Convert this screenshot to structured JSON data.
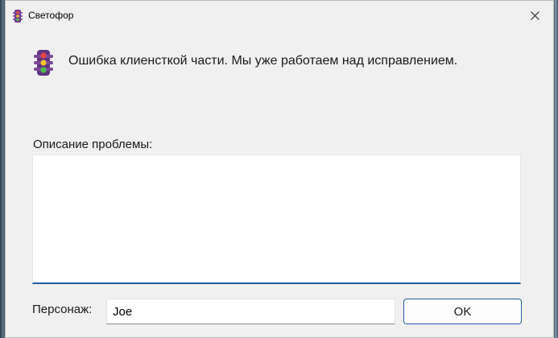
{
  "window": {
    "title": "Светофор",
    "close_icon": "close-icon",
    "app_icon": "traffic-light-icon"
  },
  "message": {
    "icon": "traffic-light-icon",
    "text": "Ошибка клиенсткой части. Мы уже работаем над исправлением."
  },
  "description": {
    "label": "Описание проблемы:",
    "value": "",
    "placeholder": ""
  },
  "character": {
    "label": "Персонаж:",
    "value": "Joe"
  },
  "buttons": {
    "ok_label": "OK"
  },
  "colors": {
    "accent": "#1f5f9e",
    "window_bg": "#f0f0f0",
    "traffic_light_body": "#6b3a8c"
  }
}
